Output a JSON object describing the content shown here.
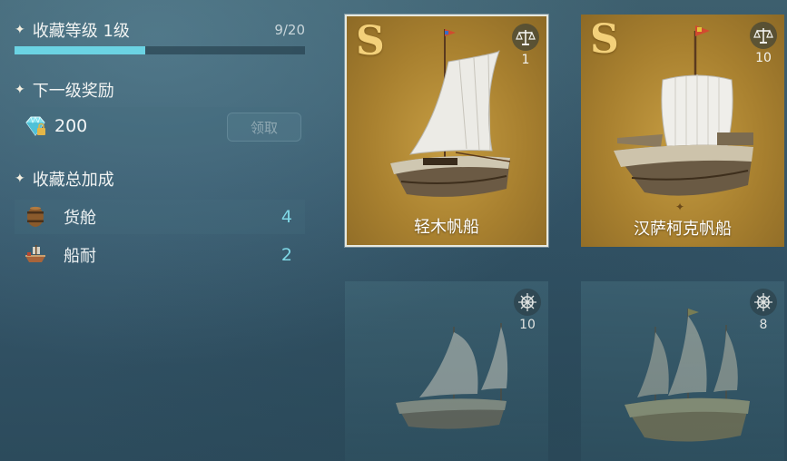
{
  "collection": {
    "level_label": "收藏等级 1级",
    "progress_text": "9/20",
    "progress_fraction": 0.45
  },
  "next_reward": {
    "title": "下一级奖励",
    "amount": "200",
    "claim_label": "领取",
    "icon": "diamond-lock-icon"
  },
  "bonus": {
    "title": "收藏总加成",
    "items": [
      {
        "label": "货舱",
        "value": "4",
        "icon": "barrel-icon"
      },
      {
        "label": "船耐",
        "value": "2",
        "icon": "ship-hull-icon"
      }
    ]
  },
  "cards": [
    {
      "grade": "S",
      "name": "轻木帆船",
      "badge_icon": "scales-icon",
      "badge_value": "1",
      "selected": true
    },
    {
      "grade": "S",
      "name": "汉萨柯克帆船",
      "badge_icon": "scales-icon",
      "badge_value": "10",
      "selected": false
    },
    {
      "grade": "",
      "name": "",
      "badge_icon": "helm-wheel-icon",
      "badge_value": "10",
      "locked": true
    },
    {
      "grade": "",
      "name": "",
      "badge_icon": "helm-wheel-icon",
      "badge_value": "8",
      "locked": true
    }
  ],
  "colors": {
    "accent": "#6bd3e3",
    "card_gold": "#b28a36",
    "grade_gold": "#f3d07a"
  }
}
